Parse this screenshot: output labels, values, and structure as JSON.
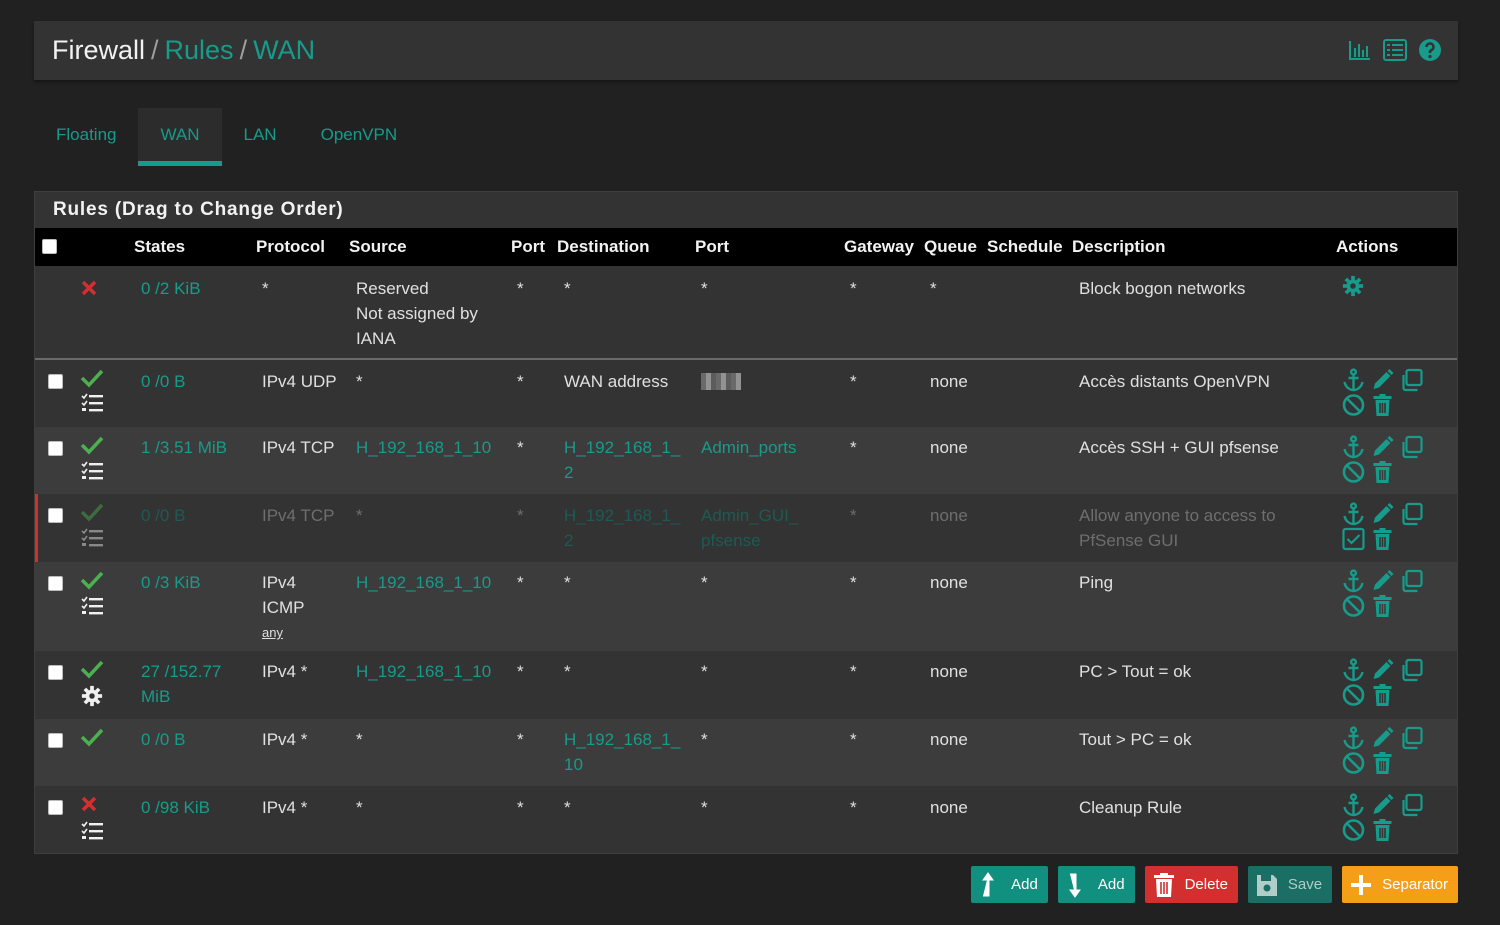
{
  "breadcrumb": {
    "home": "Firewall",
    "sep": "/",
    "rules": "Rules",
    "current": "WAN"
  },
  "header_icons": [
    "chart-icon",
    "list-icon",
    "help-icon"
  ],
  "tabs": [
    {
      "label": "Floating",
      "active": false
    },
    {
      "label": "WAN",
      "active": true
    },
    {
      "label": "LAN",
      "active": false
    },
    {
      "label": "OpenVPN",
      "active": false
    }
  ],
  "panel": {
    "title": "Rules (Drag to Change Order)"
  },
  "columns": {
    "states": "States",
    "protocol": "Protocol",
    "source": "Source",
    "src_port": "Port",
    "destination": "Destination",
    "dst_port": "Port",
    "gateway": "Gateway",
    "queue": "Queue",
    "schedule": "Schedule",
    "description": "Description",
    "actions": "Actions"
  },
  "rows": [
    {
      "action": "block",
      "log": false,
      "states": "0 /2 KiB",
      "protocol": "*",
      "source_lines": [
        "Reserved",
        "Not assigned by",
        "IANA"
      ],
      "src_port": "*",
      "destination": "*",
      "dst_port": "*",
      "gateway": "*",
      "queue": "*",
      "description": "Block bogon networks"
    },
    {
      "action": "pass",
      "log": true,
      "states": "0 /0 B",
      "protocol": "IPv4 UDP",
      "source": "*",
      "src_port": "*",
      "destination": "WAN address",
      "dst_port": "",
      "gateway": "*",
      "queue": "none",
      "description": "Accès distants OpenVPN"
    },
    {
      "action": "pass",
      "log": true,
      "states": "1 /3.51 MiB",
      "protocol": "IPv4 TCP",
      "source": "H_192_168_1_10",
      "src_port": "*",
      "destination_lines": [
        "H_192_168_1_",
        "2"
      ],
      "dst_port": "Admin_ports",
      "gateway": "*",
      "queue": "none",
      "description": "Accès SSH + GUI pfsense"
    },
    {
      "action": "pass",
      "log": true,
      "disabled": true,
      "states": "0 /0 B",
      "protocol": "IPv4 TCP",
      "source": "*",
      "src_port": "*",
      "destination_lines": [
        "H_192_168_1_",
        "2"
      ],
      "dst_port_lines": [
        "Admin_GUI_",
        "pfsense"
      ],
      "gateway": "*",
      "queue": "none",
      "description_lines": [
        "Allow anyone to access to",
        "PfSense GUI"
      ]
    },
    {
      "action": "pass",
      "log": true,
      "states": "0 /3 KiB",
      "protocol_lines": [
        "IPv4",
        "ICMP"
      ],
      "protocol_sub": "any",
      "source": "H_192_168_1_10",
      "src_port": "*",
      "destination": "*",
      "dst_port": "*",
      "gateway": "*",
      "queue": "none",
      "description": "Ping"
    },
    {
      "action": "pass",
      "log": false,
      "advanced": true,
      "states_lines": [
        "27 /152.77",
        "MiB"
      ],
      "protocol": "IPv4 *",
      "source": "H_192_168_1_10",
      "src_port": "*",
      "destination": "*",
      "dst_port": "*",
      "gateway": "*",
      "queue": "none",
      "description": "PC > Tout = ok"
    },
    {
      "action": "pass",
      "log": false,
      "states": "0 /0 B",
      "protocol": "IPv4 *",
      "source": "*",
      "src_port": "*",
      "destination_lines": [
        "H_192_168_1_",
        "10"
      ],
      "dst_port": "*",
      "gateway": "*",
      "queue": "none",
      "description": "Tout > PC = ok"
    },
    {
      "action": "block",
      "log": true,
      "states": "0 /98 KiB",
      "protocol": "IPv4 *",
      "source": "*",
      "src_port": "*",
      "destination": "*",
      "dst_port": "*",
      "gateway": "*",
      "queue": "none",
      "description": "Cleanup Rule"
    }
  ],
  "buttons": {
    "add_top": "Add",
    "add_bottom": "Add",
    "delete": "Delete",
    "save": "Save",
    "separator": "Separator"
  },
  "colors": {
    "teal": "#179b8b",
    "pass": "#4caf50",
    "block": "#d32f2f",
    "warning": "#f49f17"
  }
}
